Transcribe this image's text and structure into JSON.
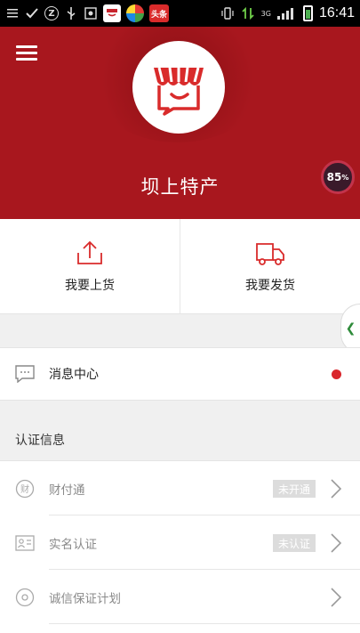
{
  "status_bar": {
    "time": "16:41",
    "app_badge": "头条",
    "network_type": "3G"
  },
  "header": {
    "store_name": "坝上特产",
    "bg_color": "#a8171e",
    "performance_badge": {
      "value": "85",
      "unit": "%"
    }
  },
  "actions": [
    {
      "label": "我要上货",
      "icon": "upload-icon"
    },
    {
      "label": "我要发货",
      "icon": "truck-icon"
    }
  ],
  "message_center": {
    "label": "消息中心",
    "has_unread": true
  },
  "certification": {
    "section_title": "认证信息",
    "items": [
      {
        "label": "财付通",
        "icon": "caifutong-icon",
        "status": "未开通"
      },
      {
        "label": "实名认证",
        "icon": "id-card-icon",
        "status": "未认证"
      },
      {
        "label": "诚信保证计划",
        "icon": "guarantee-icon",
        "status": ""
      }
    ]
  },
  "accent_color": "#d9262c"
}
